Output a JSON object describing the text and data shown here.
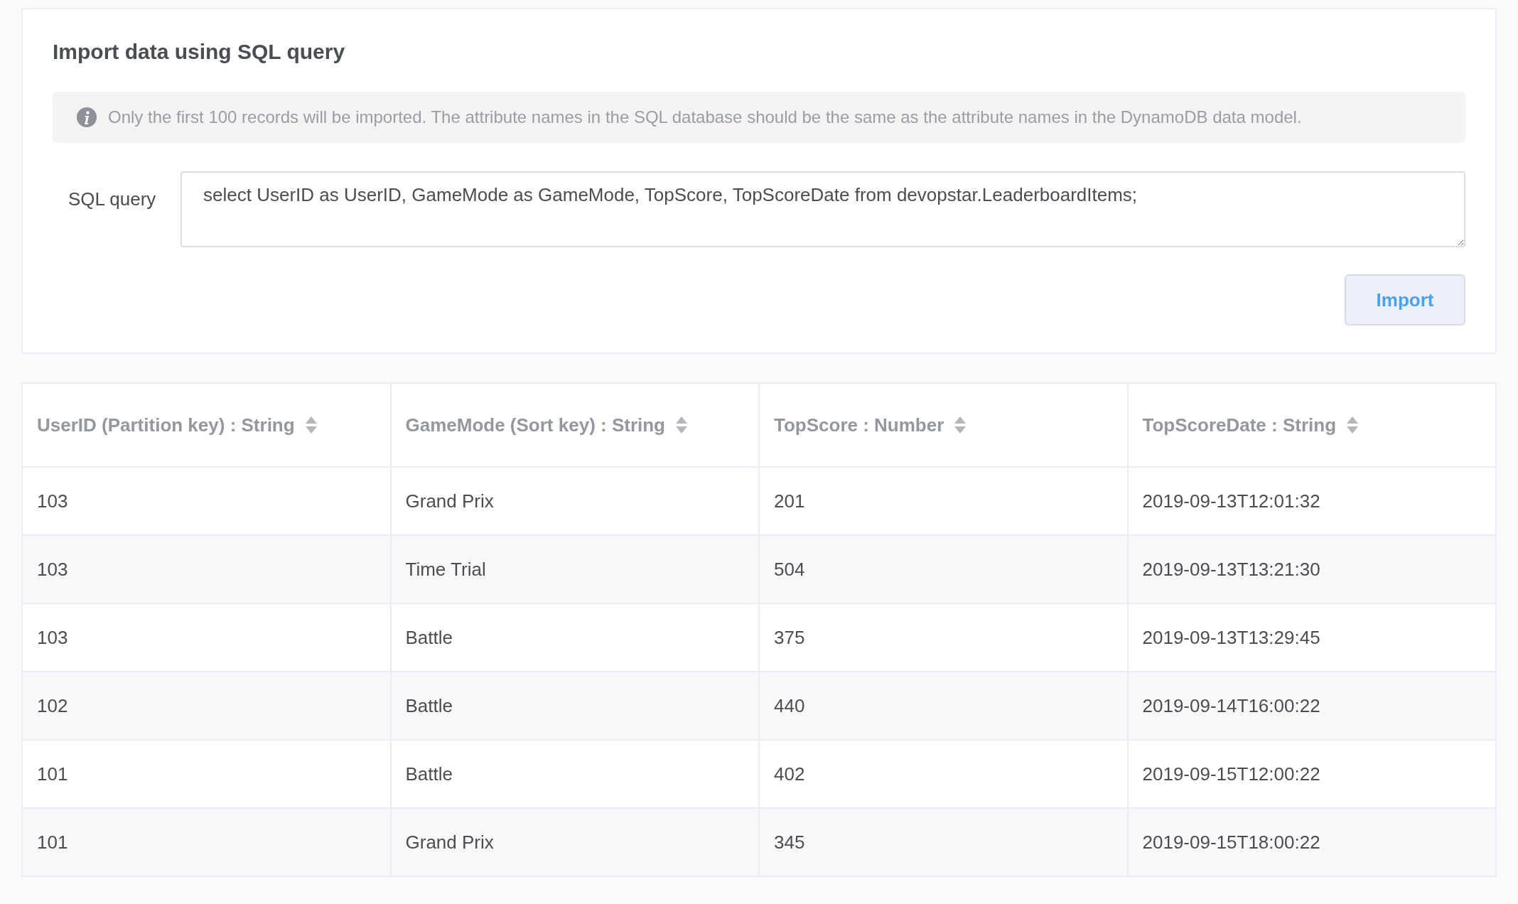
{
  "import_panel": {
    "title": "Import data using SQL query",
    "notice": "Only the first 100 records will be imported. The attribute names in the SQL database should be the same as the attribute names in the DynamoDB data model.",
    "query_label": "SQL query",
    "query_value": "select UserID as UserID, GameMode as GameMode, TopScore, TopScoreDate from devopstar.LeaderboardItems;",
    "import_button": "Import"
  },
  "table": {
    "columns": [
      "UserID (Partition key) : String",
      "GameMode (Sort key) : String",
      "TopScore : Number",
      "TopScoreDate : String"
    ],
    "rows": [
      [
        "103",
        "Grand Prix",
        "201",
        "2019-09-13T12:01:32"
      ],
      [
        "103",
        "Time Trial",
        "504",
        "2019-09-13T13:21:30"
      ],
      [
        "103",
        "Battle",
        "375",
        "2019-09-13T13:29:45"
      ],
      [
        "102",
        "Battle",
        "440",
        "2019-09-14T16:00:22"
      ],
      [
        "101",
        "Battle",
        "402",
        "2019-09-15T12:00:22"
      ],
      [
        "101",
        "Grand Prix",
        "345",
        "2019-09-15T18:00:22"
      ]
    ]
  }
}
